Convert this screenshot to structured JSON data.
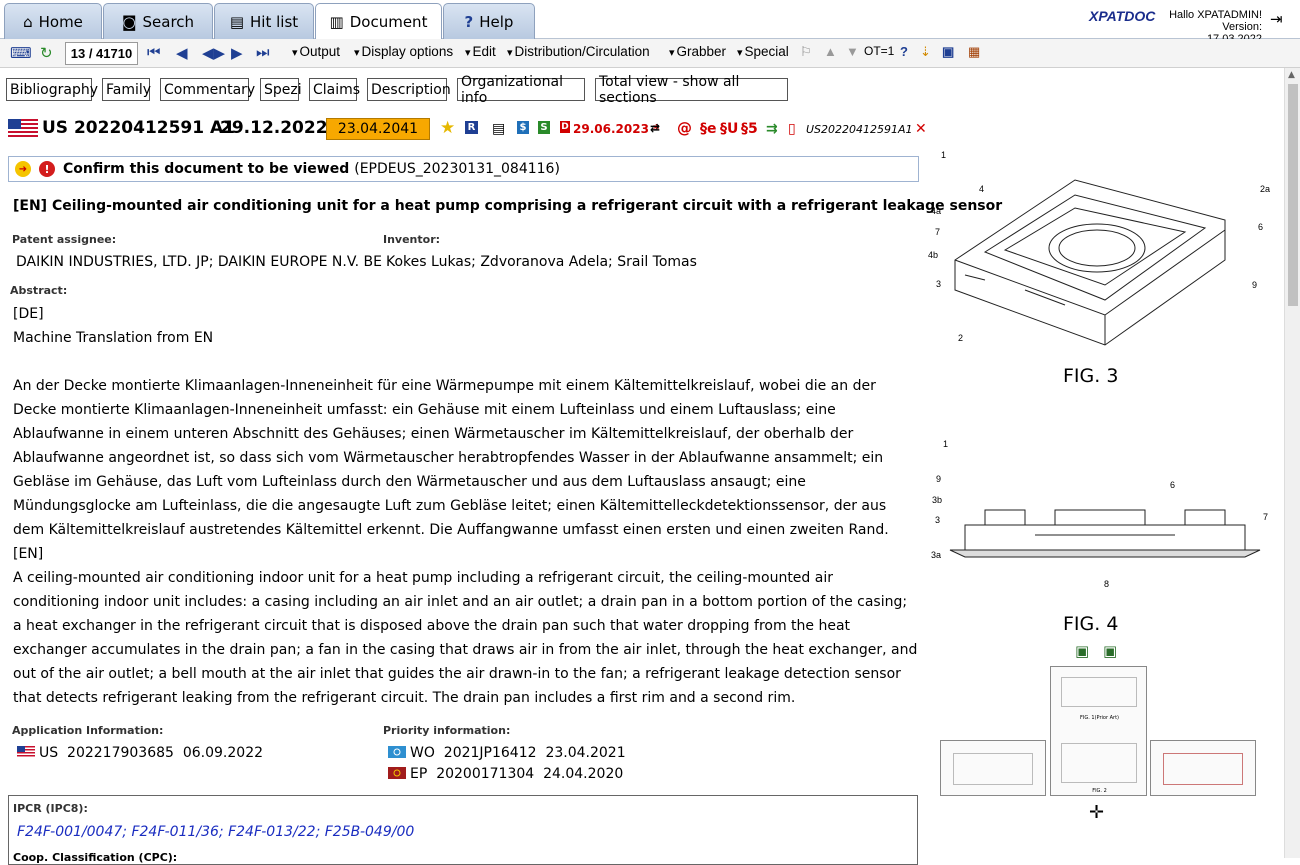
{
  "tabs": [
    {
      "label": "Home",
      "icon": "home-icon"
    },
    {
      "label": "Search",
      "icon": "binoculars-icon"
    },
    {
      "label": "Hit list",
      "icon": "list-icon"
    },
    {
      "label": "Document",
      "icon": "document-icon",
      "active": true
    },
    {
      "label": "Help",
      "icon": "help-icon"
    }
  ],
  "brand": "XPATDOC",
  "user": {
    "greeting": "Hallo XPATADMIN!",
    "version": "Version: 17.03.2022"
  },
  "toolbar": {
    "counter": "13 / 41710",
    "menus": [
      "Output",
      "Display options",
      "Edit",
      "Distribution/Circulation",
      "Grabber",
      "Special"
    ],
    "ot": "OT=1",
    "help": "?"
  },
  "sections": [
    "Bibliography",
    "Family",
    "Commentary",
    "Spezi",
    "Claims",
    "Description",
    "Organizational info",
    "Total view - show all sections"
  ],
  "header": {
    "pub_number": "US 20220412591 A1",
    "pub_date": "29.12.2022",
    "expiry": "23.04.2041",
    "r_badge": "R",
    "s1": "$",
    "s2": "S",
    "status_date": "29.06.2023 *",
    "para_e": "§e",
    "para_u": "§U",
    "para_5": "§5",
    "pub_number_short": "US20220412591A1"
  },
  "confirm": {
    "label": "Confirm this document to be viewed",
    "ref": "(EPDEUS_20230131_084116)"
  },
  "title": "[EN] Ceiling-mounted air conditioning unit for a heat pump comprising a refrigerant circuit with a refrigerant leakage sensor",
  "assignee": {
    "label": "Patent assignee:",
    "value": "DAIKIN INDUSTRIES, LTD. JP; DAIKIN EUROPE N.V. BE"
  },
  "inventor": {
    "label": "Inventor:",
    "value": "Kokes Lukas; Zdvoranova Adela; Srail Tomas"
  },
  "abstract": {
    "label": "Abstract:",
    "de_tag": "[DE]",
    "mt_note": "Machine Translation from EN",
    "de_text": "An der Decke montierte Klimaanlagen-Inneneinheit für eine Wärmepumpe mit einem Kältemittelkreislauf, wobei die an der Decke montierte Klimaanlagen-Inneneinheit umfasst: ein Gehäuse mit einem Lufteinlass und einem Luftauslass; eine Ablaufwanne in einem unteren Abschnitt des Gehäuses; einen Wärmetauscher im Kältemittelkreislauf, der oberhalb der Ablaufwanne angeordnet ist, so dass sich vom Wärmetauscher herabtropfendes Wasser in der Ablaufwanne ansammelt; ein Gebläse im Gehäuse, das Luft vom Lufteinlass durch den Wärmetauscher und aus dem Luftauslass ansaugt; eine Mündungsglocke am Lufteinlass, die die angesaugte Luft zum Gebläse leitet; einen Kältemittelleckdetektionssensor, der aus dem Kältemittelkreislauf austretendes Kältemittel erkennt. Die Auffangwanne umfasst einen ersten und einen zweiten Rand.",
    "en_tag": "[EN]",
    "en_text": "A ceiling-mounted air conditioning indoor unit for a heat pump including a refrigerant circuit, the ceiling-mounted air conditioning indoor unit includes: a casing including an air inlet and an air outlet; a drain pan in a bottom portion of the casing; a heat exchanger in the refrigerant circuit that is disposed above the drain pan such that water dropping from the heat exchanger accumulates in the drain pan; a fan in the casing that draws air in from the air inlet, through the heat exchanger, and out of the air outlet; a bell mouth at the air inlet that guides the air drawn-in to the fan; a refrigerant leakage detection sensor that detects refrigerant leaking from the refrigerant circuit. The drain pan includes a first rim and a second rim."
  },
  "application": {
    "label": "Application Information:",
    "country": "US",
    "number": "202217903685",
    "date": "06.09.2022"
  },
  "priority": {
    "label": "Priority information:",
    "items": [
      {
        "country": "WO",
        "number": "2021JP16412",
        "date": "23.04.2021"
      },
      {
        "country": "EP",
        "number": "20200171304",
        "date": "24.04.2020"
      }
    ]
  },
  "ipcr": {
    "label": "IPCR (IPC8):",
    "codes": [
      "F24F-001/0047",
      "F24F-011/36",
      "F24F-013/22",
      "F25B-049/00"
    ]
  },
  "cpc_label": "Coop. Classification (CPC):",
  "figures": {
    "fig3": "FIG. 3",
    "fig4": "FIG. 4",
    "fig3_labels": [
      "1",
      "4",
      "4a",
      "7",
      "4b",
      "3",
      "2",
      "2a",
      "6",
      "9"
    ],
    "fig4_labels": [
      "1",
      "9",
      "3b",
      "3",
      "3a",
      "6",
      "7",
      "8"
    ],
    "thumb_caption_1": "FIG. 1(Prior Art)",
    "thumb_caption_2": "FIG. 2"
  },
  "colors": {
    "accent": "#1a2d8c",
    "expiry_bg": "#f7a800",
    "status_red": "#d10000",
    "link_blue": "#1a2dc0"
  }
}
